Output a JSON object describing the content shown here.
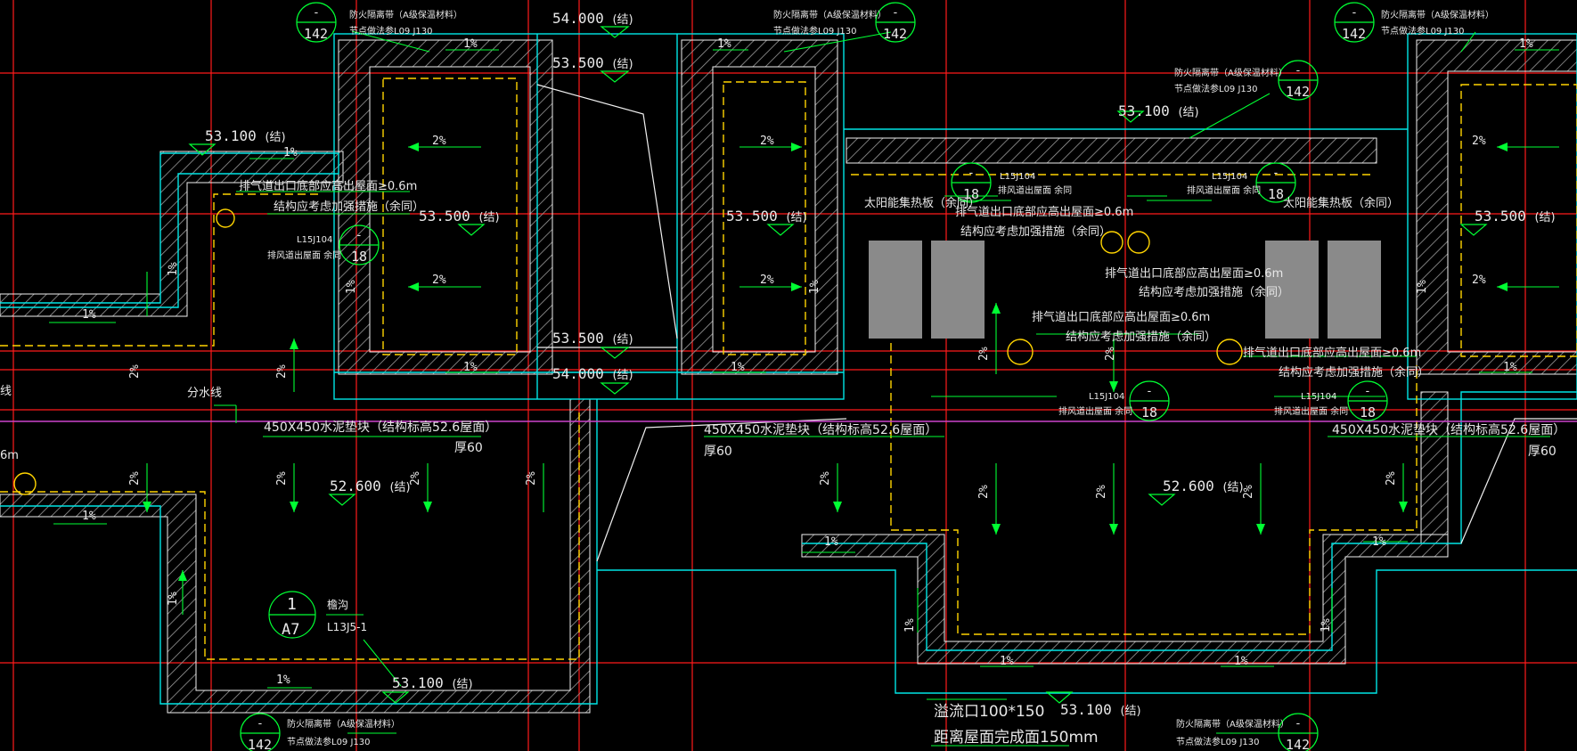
{
  "colors": {
    "background": "#000000",
    "grid_red": "#ff1a1a",
    "outline_cyan": "#00e6e6",
    "parapet_white": "#f0f0f0",
    "hatch": "#9a9a9a",
    "waterproof_yellow": "#ffd400",
    "leader_green": "#00ff33",
    "purple": "#cc44cc",
    "text_white": "#e8e8e8",
    "panel_gray": "#8a8a8a"
  },
  "elevations": [
    {
      "value": "54.000",
      "suffix": "(结)"
    },
    {
      "value": "53.500",
      "suffix": "(结)"
    },
    {
      "value": "53.100",
      "suffix": "(结)"
    },
    {
      "value": "53.100",
      "suffix": "(结)"
    },
    {
      "value": "53.500",
      "suffix": "(结)"
    },
    {
      "value": "53.500",
      "suffix": "(结)"
    },
    {
      "value": "53.500",
      "suffix": "(结)"
    },
    {
      "value": "53.500",
      "suffix": "(结)"
    },
    {
      "value": "54.000",
      "suffix": "(结)"
    },
    {
      "value": "52.600",
      "suffix": "(结)"
    },
    {
      "value": "52.600",
      "suffix": "(结)"
    },
    {
      "value": "53.100",
      "suffix": "(结)"
    },
    {
      "value": "53.100",
      "suffix": "(结)"
    }
  ],
  "slopes": {
    "two_percent": "2%",
    "one_percent": "1%"
  },
  "notes": {
    "vent_line1": "排气道出口底部应高出屋面≥0.6m",
    "vent_line2": "结构应考虑加强措施（余同）",
    "vent_line1_left": "排气道出口底部应高出屋面≥0.6m",
    "vent_line2_left": "结构应考虑加强措施（余同）",
    "solar_panel": "太阳能集热板（余同）",
    "fire_band_line1": "防火隔离带（A级保温材料）",
    "fire_band_line2": "节点做法参L09 J130",
    "vent_detail_code": "L15J104",
    "vent_detail_desc": "排风道出屋面 余同",
    "cement_pad": "450X450水泥垫块（结构标高52.6屋面）",
    "cement_pad_thick": "厚60",
    "divide_line": "分水线",
    "gutter": "檐沟",
    "gutter_ref": "L13J5-1",
    "overflow_line1": "溢流口100*150",
    "overflow_line2": "距离屋面完成面150mm",
    "truncated_left": "线",
    "truncated_6m": "6m"
  },
  "callouts": {
    "fire_band_top": "-",
    "fire_band_bottom": "142",
    "vent_top": "-",
    "vent_bottom": "18",
    "gutter_top": "1",
    "gutter_bottom": "A7"
  }
}
